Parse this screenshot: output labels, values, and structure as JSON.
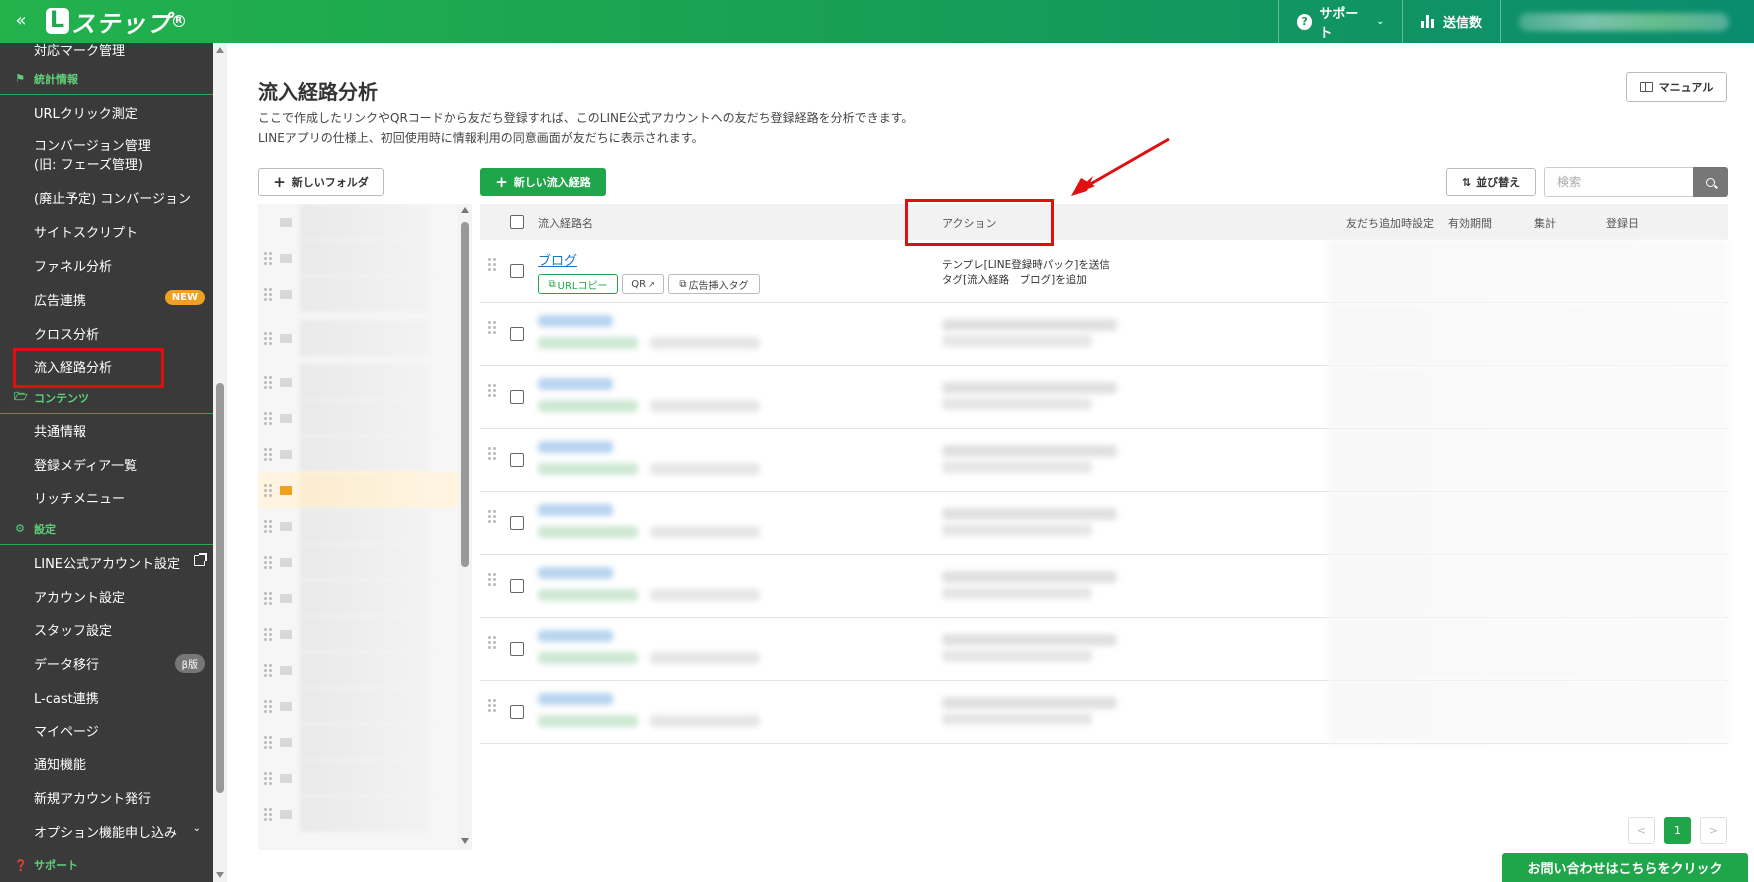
{
  "topbar": {
    "collapse_icon": "«",
    "logo_text": "ステップ",
    "logo_letter": "L",
    "support_label": "サポート",
    "send_count_label": "送信数"
  },
  "sidebar": {
    "items": [
      {
        "label": "対応マーク管理"
      },
      {
        "section": "統計情報"
      },
      {
        "label": "URLクリック測定"
      },
      {
        "label_line1": "コンバージョン管理",
        "label_line2": "(旧: フェーズ管理)"
      },
      {
        "label": "(廃止予定) コンバージョン"
      },
      {
        "label": "サイトスクリプト"
      },
      {
        "label": "ファネル分析"
      },
      {
        "label": "広告連携",
        "badge": "NEW"
      },
      {
        "label": "クロス分析"
      },
      {
        "label": "流入経路分析",
        "highlighted": true
      },
      {
        "section": "コンテンツ"
      },
      {
        "label": "共通情報"
      },
      {
        "label": "登録メディア一覧"
      },
      {
        "label": "リッチメニュー"
      },
      {
        "section": "設定"
      },
      {
        "label": "LINE公式アカウント設定",
        "icon": "external-link-icon"
      },
      {
        "label": "アカウント設定"
      },
      {
        "label": "スタッフ設定"
      },
      {
        "label": "データ移行",
        "badge": "β版"
      },
      {
        "label": "L-cast連携"
      },
      {
        "label": "マイページ"
      },
      {
        "label": "通知機能"
      },
      {
        "label": "新規アカウント発行"
      },
      {
        "label": "オプション機能申し込み",
        "icon": "chevron-down-icon"
      },
      {
        "section": "サポート"
      }
    ]
  },
  "main": {
    "title": "流入経路分析",
    "description_line1": "ここで作成したリンクやQRコードから友だち登録すれば、このLINE公式アカウントへの友だち登録経路を分析できます。",
    "description_line2": "LINEアプリの仕様上、初回使用時に情報利用の同意画面が友だちに表示されます。",
    "manual_label": "マニュアル",
    "new_folder_label": "新しいフォルダ",
    "new_route_label": "新しい流入経路",
    "sort_label": "並び替え",
    "search_placeholder": "検索"
  },
  "table": {
    "headers": {
      "name": "流入経路名",
      "action": "アクション",
      "friend_add_setting": "友だち追加時設定",
      "valid_period": "有効期間",
      "aggregate": "集計",
      "registered_date": "登録日"
    },
    "first_row": {
      "name": "ブログ",
      "url_copy_label": "URLコピー",
      "qr_label": "QR",
      "ad_tag_label": "広告挿入タグ",
      "action_line1": "テンプレ[LINE登録時パック]を送信",
      "action_line2": "タグ[流入経路　ブログ]を追加"
    }
  },
  "pagination": {
    "prev": "<",
    "current": "1",
    "next": ">"
  },
  "contact_button": "お問い合わせはこちらをクリック",
  "colors": {
    "brand_green": "#1fa64a",
    "sidebar_bg": "#3a3a3a",
    "highlight_red": "#e01010"
  }
}
